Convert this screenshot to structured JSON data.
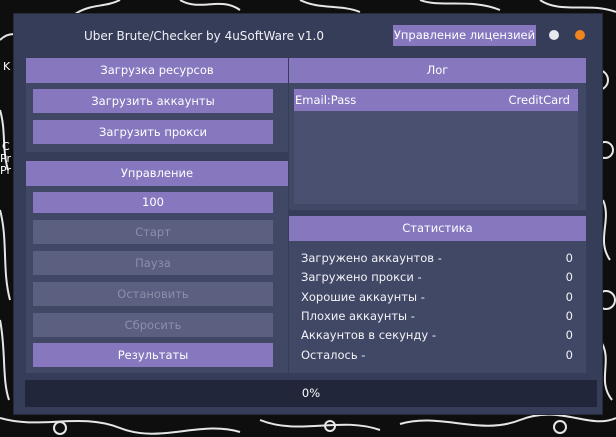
{
  "window": {
    "title": "Uber Brute/Checker by 4uSoftWare v1.0",
    "license_button": "Управление лицензией",
    "accent_color": "#8677bf",
    "close_dot_color": "#f0851e"
  },
  "resources": {
    "header": "Загрузка ресурсов",
    "load_accounts": "Загрузить аккаунты",
    "load_proxy": "Загрузить прокси"
  },
  "control": {
    "header": "Управление",
    "threads_value": "100",
    "start": "Старт",
    "pause": "Пауза",
    "stop": "Остановить",
    "reset": "Сбросить",
    "results": "Результаты"
  },
  "log": {
    "header": "Лог",
    "columns": [
      "Email:Pass",
      "CreditCard"
    ]
  },
  "stats": {
    "header": "Статистика",
    "rows": [
      {
        "label": "Загружено аккаунтов -",
        "value": "0"
      },
      {
        "label": "Загружено прокси -",
        "value": "0"
      },
      {
        "label": "Хорошие аккаунты -",
        "value": "0"
      },
      {
        "label": "Плохие аккаунты -",
        "value": "0"
      },
      {
        "label": "Аккаунтов в секунду -",
        "value": "0"
      },
      {
        "label": "Осталось -",
        "value": "0"
      }
    ]
  },
  "progress": {
    "text": "0%",
    "fraction": 0
  },
  "background_fragments": [
    "K",
    "C",
    "Pr",
    "Pr"
  ]
}
